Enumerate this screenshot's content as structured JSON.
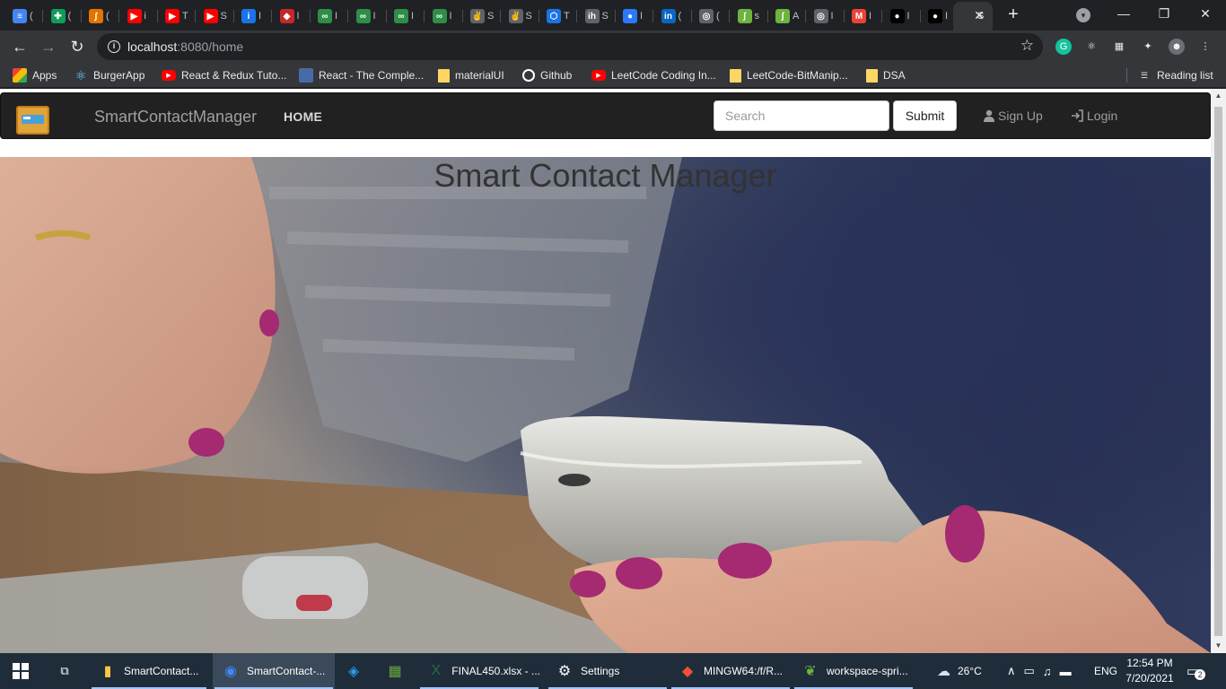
{
  "browser": {
    "tabs": [
      {
        "title": "(",
        "icon": "docs-icon",
        "color": "#4285f4",
        "glyph": "≡"
      },
      {
        "title": "(",
        "icon": "sheets-icon",
        "color": "#0f9d58",
        "glyph": "✚"
      },
      {
        "title": "(",
        "icon": "leaf-icon",
        "color": "#e37400",
        "glyph": "∫"
      },
      {
        "title": "i",
        "icon": "youtube-icon",
        "color": "#ff0000",
        "glyph": "▶"
      },
      {
        "title": "T",
        "icon": "youtube-icon",
        "color": "#ff0000",
        "glyph": "▶"
      },
      {
        "title": "S",
        "icon": "youtube-icon",
        "color": "#ff0000",
        "glyph": "▶"
      },
      {
        "title": "I",
        "icon": "info-icon",
        "color": "#1a73e8",
        "glyph": "i"
      },
      {
        "title": "I",
        "icon": "shield-icon",
        "color": "#c62828",
        "glyph": "◆"
      },
      {
        "title": "I",
        "icon": "gfg-icon",
        "color": "#2f8d46",
        "glyph": "∞"
      },
      {
        "title": "I",
        "icon": "gfg-icon",
        "color": "#2f8d46",
        "glyph": "∞"
      },
      {
        "title": "I",
        "icon": "gfg-icon",
        "color": "#2f8d46",
        "glyph": "∞"
      },
      {
        "title": "I",
        "icon": "gfg-icon",
        "color": "#2f8d46",
        "glyph": "∞"
      },
      {
        "title": "S",
        "icon": "peace-icon",
        "color": "#5f6368",
        "glyph": "✌"
      },
      {
        "title": "S",
        "icon": "peace-icon",
        "color": "#5f6368",
        "glyph": "✌"
      },
      {
        "title": "T",
        "icon": "hex-icon",
        "color": "#1a73e8",
        "glyph": "⬡"
      },
      {
        "title": "S",
        "icon": "ih-icon",
        "color": "#5f6368",
        "glyph": "ih"
      },
      {
        "title": "I",
        "icon": "circle-icon",
        "color": "#2979ff",
        "glyph": "●"
      },
      {
        "title": "(",
        "icon": "linkedin-icon",
        "color": "#0a66c2",
        "glyph": "in"
      },
      {
        "title": "(",
        "icon": "globe-icon",
        "color": "#5f6368",
        "glyph": "◎"
      },
      {
        "title": "s",
        "icon": "springleaf-icon",
        "color": "#6db33f",
        "glyph": "ʃ"
      },
      {
        "title": "A",
        "icon": "springleaf-icon",
        "color": "#6db33f",
        "glyph": "ʃ"
      },
      {
        "title": "I",
        "icon": "globe-icon",
        "color": "#5f6368",
        "glyph": "◎"
      },
      {
        "title": "I",
        "icon": "gmail-icon",
        "color": "#ea4335",
        "glyph": "M"
      },
      {
        "title": "I",
        "icon": "github-icon",
        "color": "#000000",
        "glyph": "●"
      },
      {
        "title": "I",
        "icon": "github-icon",
        "color": "#000000",
        "glyph": "●"
      },
      {
        "title": "S",
        "icon": "page-icon",
        "color": "#35363a",
        "glyph": "",
        "active": true
      }
    ],
    "new_tab": "+",
    "close_glyph": "✕",
    "window_controls": {
      "minimize": "—",
      "restore": "❐",
      "close": "✕"
    },
    "url_host": "localhost",
    "url_rest": ":8080/home",
    "bookmarks": [
      {
        "label": "Apps",
        "icon": "apps-grid-icon",
        "color": "#e8453c"
      },
      {
        "label": "BurgerApp",
        "icon": "react-icon",
        "color": "#61dafb"
      },
      {
        "label": "React & Redux Tuto...",
        "icon": "youtube-icon",
        "color": "#ff0000"
      },
      {
        "label": "React - The Comple...",
        "icon": "tata-icon",
        "color": "#486aa8"
      },
      {
        "label": "materialUI",
        "icon": "folder-icon",
        "color": "#fdd663"
      },
      {
        "label": "Github",
        "icon": "github-icon",
        "color": "#ffffff"
      },
      {
        "label": "LeetCode Coding In...",
        "icon": "youtube-icon",
        "color": "#ff0000"
      },
      {
        "label": "LeetCode-BitManip...",
        "icon": "folder-icon",
        "color": "#fdd663"
      },
      {
        "label": "DSA",
        "icon": "folder-icon",
        "color": "#fdd663"
      }
    ],
    "reading_list": "Reading list"
  },
  "page": {
    "brand": "SmartContactManager",
    "nav_home": "HOME",
    "search_placeholder": "Search",
    "submit_label": "Submit",
    "signup_label": "Sign Up",
    "login_label": "Login",
    "hero_title": "Smart Contact Manager"
  },
  "taskbar": {
    "items": [
      {
        "label": "SmartContact...",
        "icon": "folder-icon",
        "color": "#f6c844"
      },
      {
        "label": "SmartContact-...",
        "icon": "chrome-icon",
        "color": "#4285f4",
        "active": true
      },
      {
        "label": "",
        "icon": "vscode-icon",
        "color": "#2b9ae8"
      },
      {
        "label": "",
        "icon": "chart-app-icon",
        "color": "#68a63c"
      },
      {
        "label": "FINAL450.xlsx - ...",
        "icon": "excel-icon",
        "color": "#1d6f42"
      },
      {
        "label": "Settings",
        "icon": "gear-icon",
        "color": "#ffffff"
      },
      {
        "label": "MINGW64:/f/R...",
        "icon": "git-icon",
        "color": "#f05033"
      },
      {
        "label": "workspace-spri...",
        "icon": "spring-icon",
        "color": "#6db33f"
      }
    ],
    "weather": "26°C",
    "language": "ENG",
    "time": "12:54 PM",
    "date": "7/20/2021",
    "notifications": "2"
  }
}
